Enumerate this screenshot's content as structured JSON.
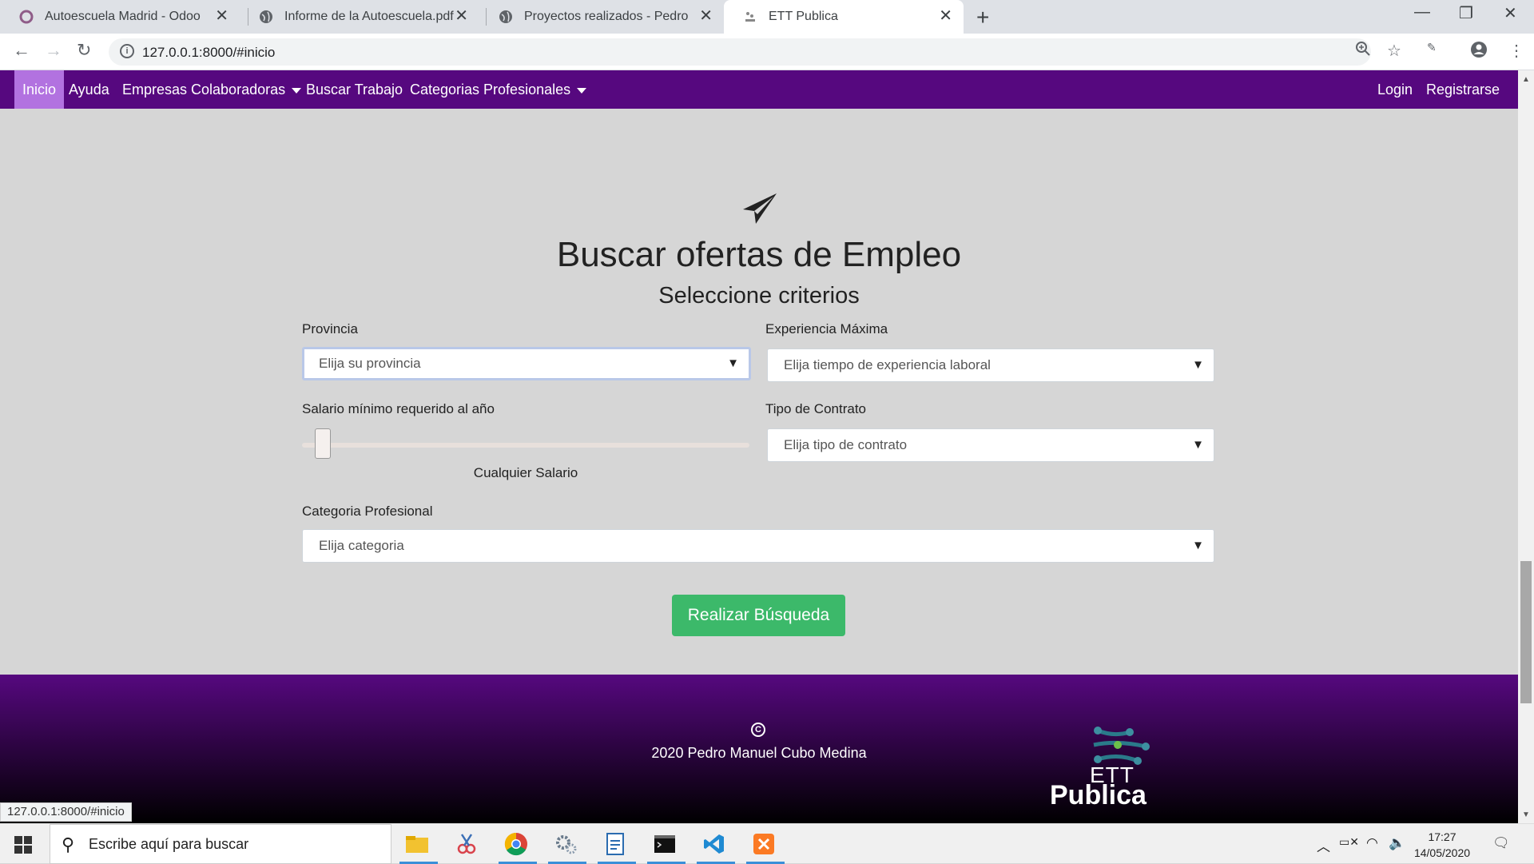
{
  "browser": {
    "tabs": [
      {
        "title": "Autoescuela Madrid - Odoo",
        "active": false
      },
      {
        "title": "Informe de la Autoescuela.pdf",
        "active": false
      },
      {
        "title": "Proyectos realizados - Pedro",
        "active": false
      },
      {
        "title": "ETT Publica",
        "active": true
      }
    ],
    "url": "127.0.0.1:8000/#inicio",
    "status_url": "127.0.0.1:8000/#inicio"
  },
  "nav": {
    "items": [
      "Inicio",
      "Ayuda",
      "Empresas Colaboradoras",
      "Buscar Trabajo",
      "Categorias Profesionales"
    ],
    "right": [
      "Login",
      "Registrarse"
    ]
  },
  "search": {
    "title": "Buscar ofertas de Empleo",
    "subtitle": "Seleccione criterios",
    "provincia_label": "Provincia",
    "provincia_value": "Elija su provincia",
    "experiencia_label": "Experiencia Máxima",
    "experiencia_value": "Elija tiempo de experiencia laboral",
    "salario_label": "Salario mínimo requerido al año",
    "salario_value": "Cualquier Salario",
    "salario_level": 0,
    "contrato_label": "Tipo de Contrato",
    "contrato_value": "Elija tipo de contrato",
    "categoria_label": "Categoria Profesional",
    "categoria_value": "Elija categoria",
    "button": "Realizar Búsqueda"
  },
  "footer": {
    "copyright": "2020 Pedro Manuel Cubo Medina",
    "logo_line1": "ETT",
    "logo_line2": "Publica"
  },
  "taskbar": {
    "search_placeholder": "Escribe aquí para buscar",
    "time": "17:27",
    "date": "14/05/2020"
  },
  "colors": {
    "nav": "#56087f",
    "nav_active": "#b272e0",
    "button": "#3cb96a",
    "background": "#d6d6d6"
  }
}
